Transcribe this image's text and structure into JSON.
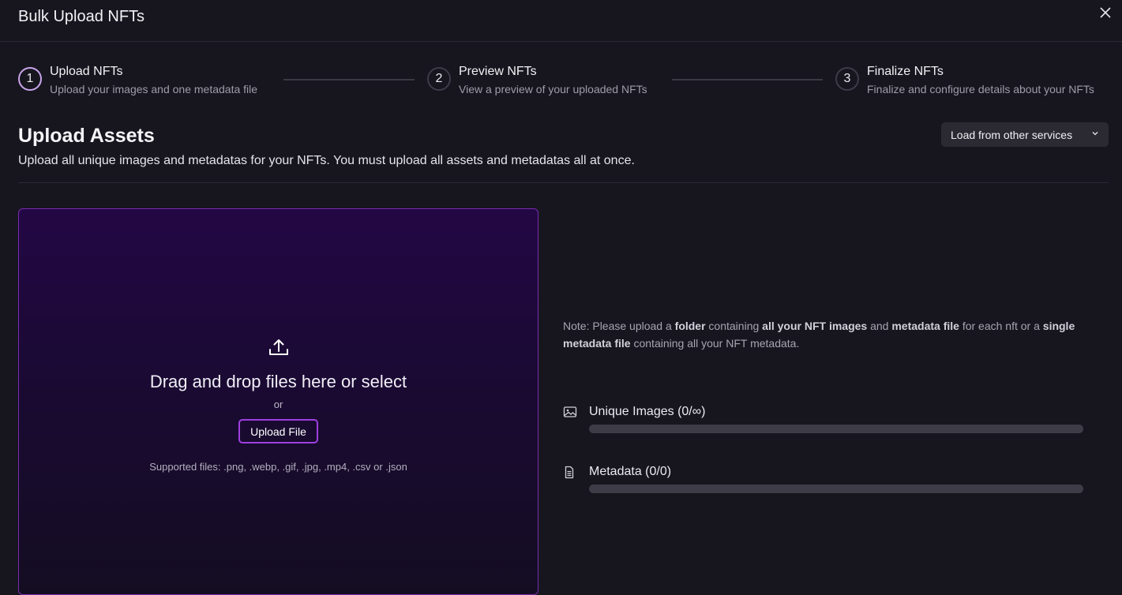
{
  "header": {
    "title": "Bulk Upload NFTs"
  },
  "steps": [
    {
      "number": "1",
      "title": "Upload NFTs",
      "subtitle": "Upload your images and one metadata file",
      "active": true
    },
    {
      "number": "2",
      "title": "Preview NFTs",
      "subtitle": "View a preview of your uploaded NFTs",
      "active": false
    },
    {
      "number": "3",
      "title": "Finalize NFTs",
      "subtitle": "Finalize and configure details about your NFTs",
      "active": false
    }
  ],
  "section": {
    "title": "Upload Assets",
    "description": "Upload all unique images and metadatas for your NFTs. You must upload all assets and metadatas all at once.",
    "load_button": "Load from other services"
  },
  "dropzone": {
    "title": "Drag and drop files here or select",
    "or": "or",
    "button": "Upload File",
    "supported": "Supported files: .png, .webp, .gif, .jpg, .mp4, .csv or .json"
  },
  "note": {
    "prefix": "Note: Please upload a ",
    "folder": "folder",
    "mid1": " containing ",
    "images": "all your NFT images",
    "mid2": " and ",
    "metadata_file": "metadata file",
    "mid3": " for each nft or a ",
    "single": "single metadata file",
    "suffix": " containing all your NFT metadata."
  },
  "stats": {
    "images": {
      "label": "Unique Images (0/∞)",
      "progress": 0,
      "icon": "image-icon"
    },
    "metadata": {
      "label": "Metadata (0/0)",
      "progress": 0,
      "icon": "document-icon"
    }
  },
  "colors": {
    "accent": "#9f3fe0",
    "active_step": "#c9a5ea",
    "background": "#17161f"
  }
}
